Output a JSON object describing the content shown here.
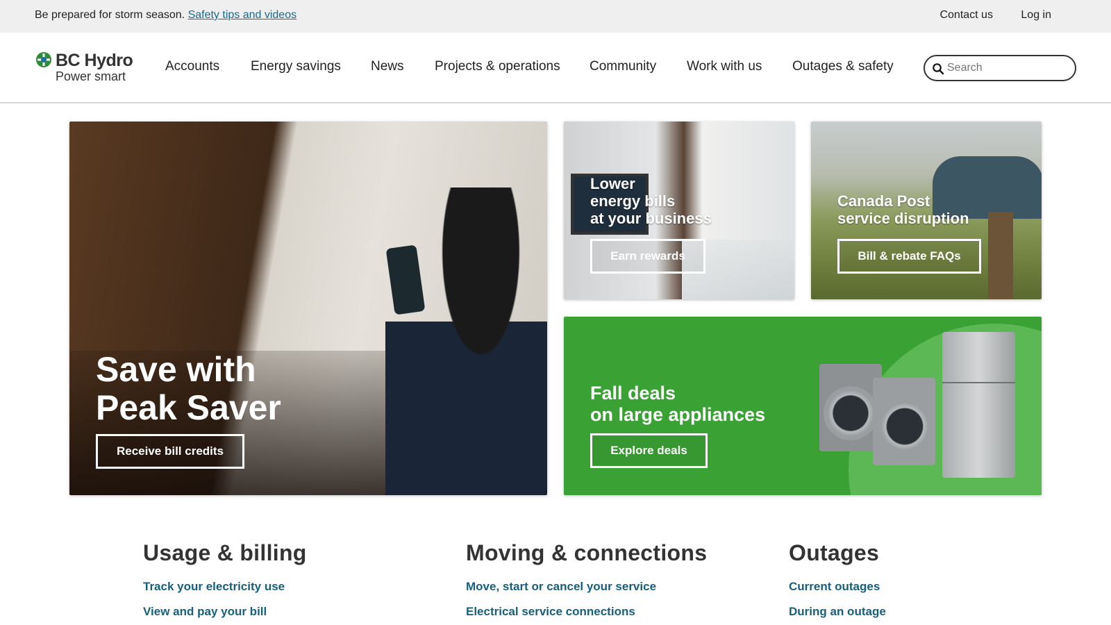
{
  "topbar": {
    "message": "Be prepared for storm season.",
    "link": "Safety tips and videos",
    "contact": "Contact us",
    "login": "Log in"
  },
  "logo": {
    "brand": "BC Hydro",
    "tagline": "Power smart"
  },
  "nav": {
    "items": [
      "Accounts",
      "Energy savings",
      "News",
      "Projects & operations",
      "Community",
      "Work with us",
      "Outages & safety"
    ]
  },
  "search": {
    "placeholder": "Search"
  },
  "hero": {
    "title_line1": "Save with",
    "title_line2": "Peak Saver",
    "button": "Receive bill credits"
  },
  "business_tile": {
    "line1": "Lower",
    "line2": "energy bills",
    "line3": "at your business",
    "button": "Earn rewards"
  },
  "post_tile": {
    "line1": "Canada Post",
    "line2": "service disruption",
    "button": "Bill & rebate FAQs"
  },
  "deals_tile": {
    "line1": "Fall deals",
    "line2": "on large appliances",
    "button": "Explore deals"
  },
  "columns": [
    {
      "heading": "Usage & billing",
      "links": [
        "Track your electricity use",
        "View and pay your bill"
      ]
    },
    {
      "heading": "Moving & connections",
      "links": [
        "Move, start or cancel your service",
        "Electrical service connections"
      ]
    },
    {
      "heading": "Outages",
      "links": [
        "Current outages",
        "During an outage"
      ]
    }
  ],
  "colors": {
    "brand_green": "#3aa135",
    "link_blue": "#155f7f",
    "topbar_bg": "#efefef"
  },
  "icons": {
    "logo_mark": "bchydro-logo-icon",
    "search": "search-icon"
  }
}
